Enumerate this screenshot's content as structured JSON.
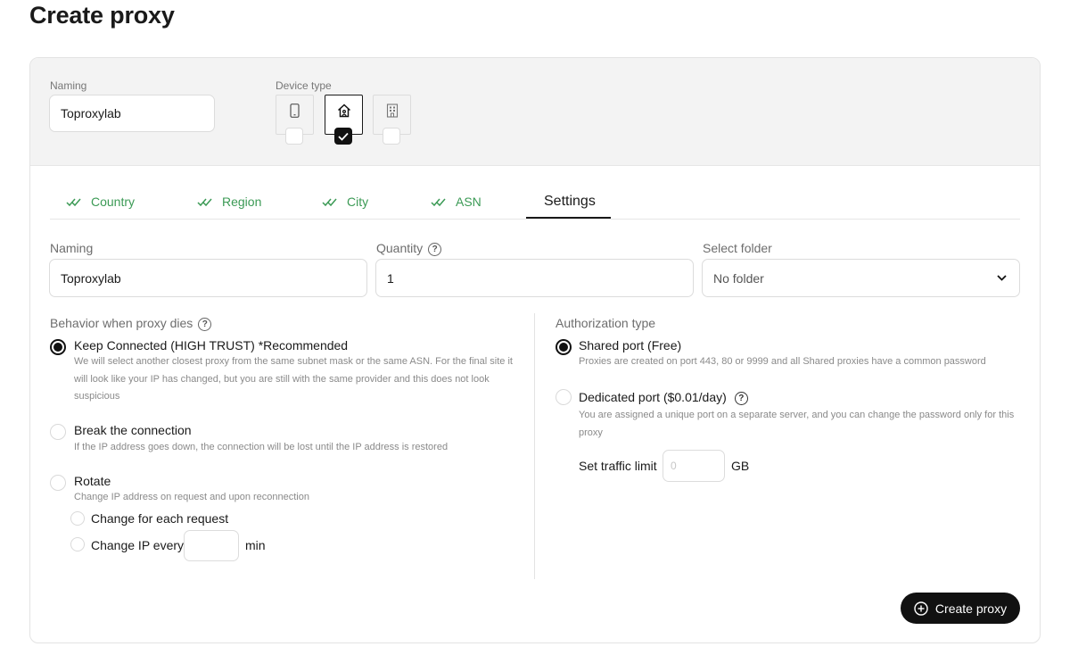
{
  "page": {
    "title": "Create proxy"
  },
  "top": {
    "naming_label": "Naming",
    "naming_value": "Toproxylab",
    "device_type_label": "Device type",
    "devices": [
      {
        "icon": "mobile-icon",
        "selected": false
      },
      {
        "icon": "home-icon",
        "selected": true
      },
      {
        "icon": "office-building-icon",
        "selected": false
      }
    ]
  },
  "tabs": [
    {
      "label": "Country",
      "done": true
    },
    {
      "label": "Region",
      "done": true
    },
    {
      "label": "City",
      "done": true
    },
    {
      "label": "ASN",
      "done": true
    },
    {
      "label": "Settings",
      "active": true
    }
  ],
  "form": {
    "naming_label": "Naming",
    "naming_value": "Toproxylab",
    "quantity_label": "Quantity",
    "quantity_value": "1",
    "folder_label": "Select folder",
    "folder_value": "No folder"
  },
  "behavior": {
    "label": "Behavior when proxy dies",
    "options": [
      {
        "title": "Keep Connected (HIGH TRUST) *Recommended",
        "desc": "We will select another closest proxy from the same subnet mask or the same ASN. For the final site it will look like your IP has changed, but you are still with the same provider and this does not look suspicious",
        "selected": true
      },
      {
        "title": "Break the connection",
        "desc": "If the IP address goes down, the connection will be lost until the IP address is restored",
        "selected": false
      },
      {
        "title": "Rotate",
        "desc": "Change IP address on request and upon reconnection",
        "selected": false
      }
    ],
    "rotate_each_request": "Change for each request",
    "rotate_every_label": "Change IP every",
    "rotate_every_value": "",
    "rotate_every_unit": "min"
  },
  "auth": {
    "label": "Authorization type",
    "shared_title": "Shared port (Free)",
    "shared_desc": "Proxies are created on port 443, 80 or 9999 and all Shared proxies have a common password",
    "dedicated_title": "Dedicated port ($0.01/day)",
    "dedicated_desc": "You are assigned a unique port on a separate server, and you can change the password only for this proxy",
    "traffic_label": "Set traffic limit",
    "traffic_placeholder": "0",
    "traffic_unit": "GB",
    "shared_selected": true
  },
  "actions": {
    "create_label": "Create proxy"
  },
  "colors": {
    "accent_green": "#3b9a55",
    "primary_dark": "#111111"
  }
}
